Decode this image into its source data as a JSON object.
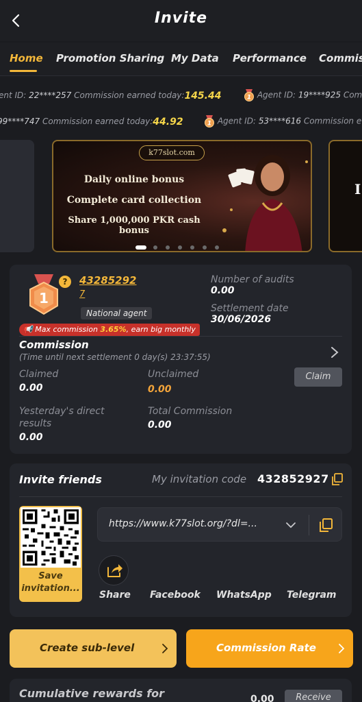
{
  "header": {
    "title": "Invite"
  },
  "tabs": [
    {
      "label": "Home"
    },
    {
      "label": "Promotion Sharing"
    },
    {
      "label": "My Data"
    },
    {
      "label": "Performance"
    },
    {
      "label": "Commiss"
    }
  ],
  "ticker1": [
    {
      "prefix": "ent ID: ",
      "id": "22****257",
      "earned_label": " Commission earned today: ",
      "amount": "145.44"
    },
    {
      "prefix": "Agent ID: ",
      "id": "19****925",
      "earned_label": " Com"
    }
  ],
  "ticker2": [
    {
      "id": "99****747",
      "earned_label": " Commission earned today: ",
      "amount": "44.92"
    },
    {
      "prefix": "Agent ID: ",
      "id": "53****616",
      "earned_label": " Commission e"
    }
  ],
  "banner": {
    "logo": "k77slot.com",
    "lines": [
      "Daily online bonus",
      "Complete card collection",
      "Share 1,000,000 PKR cash bonus"
    ],
    "next_partial": "I"
  },
  "agent": {
    "level": "1",
    "id": "43285292",
    "sub": "7",
    "badge": "National agent",
    "audits_label": "Number of audits",
    "audits_value": "0.00",
    "settlement_label": "Settlement date",
    "settlement_value": "30/06/2026",
    "promo_prefix": "Max commission ",
    "promo_highlight": "3.65%",
    "promo_suffix": ", earn big monthly"
  },
  "commission": {
    "title": "Commission",
    "subtitle": "(Time until next settlement 0 day(s) 23:37:55)",
    "claimed_label": "Claimed",
    "claimed_value": "0.00",
    "unclaimed_label": "Unclaimed",
    "unclaimed_value": "0.00",
    "claim_button": "Claim",
    "yesterday_label_1": "Yesterday's direct",
    "yesterday_label_2": "results",
    "yesterday_value": "0.00",
    "total_label": "Total Commission",
    "total_value": "0.00"
  },
  "invite": {
    "title": "Invite friends",
    "code_label": "My invitation code",
    "code": "432852927",
    "link": "https://www.k77slot.org/?dl=...",
    "save_line1": "Save",
    "save_line2": "invitation...",
    "share_labels": [
      "Share",
      "Facebook",
      "WhatsApp",
      "Telegram"
    ]
  },
  "buttons": {
    "create_sub": "Create sub-level",
    "commission_rate": "Commission Rate"
  },
  "cumulative": {
    "text": "Cumulative rewards for",
    "value": "0.00",
    "button": "Receive"
  },
  "colors": {
    "accent": "#f3b73a",
    "orange": "#f7a51b",
    "promo_red": "#c7312a"
  }
}
